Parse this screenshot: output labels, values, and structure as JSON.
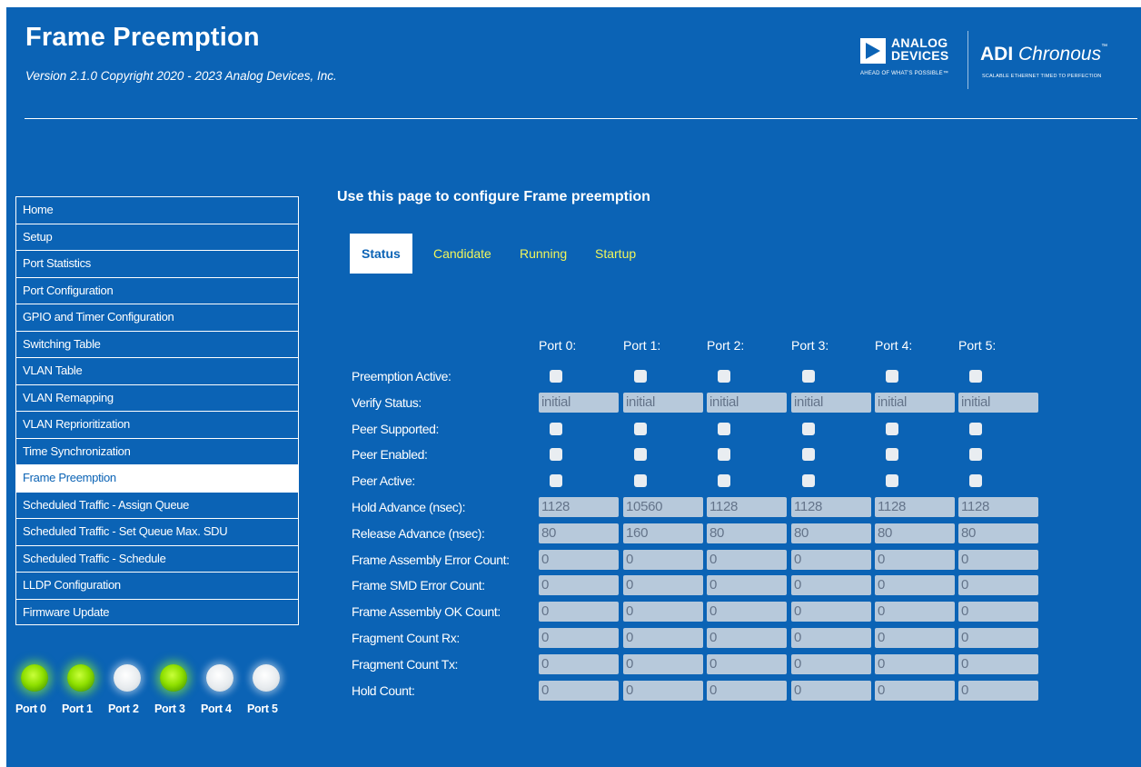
{
  "header": {
    "title": "Frame Preemption",
    "version": "Version 2.1.0 Copyright 2020 - 2023 Analog Devices, Inc.",
    "logo_left": {
      "name_line1": "ANALOG",
      "name_line2": "DEVICES",
      "tagline": "AHEAD OF WHAT'S POSSIBLE™"
    },
    "logo_right": {
      "brand_bold": "ADI",
      "brand_italic": "Chronous",
      "trademark": "™",
      "tagline": "SCALABLE ETHERNET TIMED TO PERFECTION"
    }
  },
  "sidebar": {
    "items": [
      {
        "label": "Home"
      },
      {
        "label": "Setup"
      },
      {
        "label": "Port Statistics"
      },
      {
        "label": "Port Configuration"
      },
      {
        "label": "GPIO and Timer Configuration"
      },
      {
        "label": "Switching Table"
      },
      {
        "label": "VLAN Table"
      },
      {
        "label": "VLAN Remapping"
      },
      {
        "label": "VLAN Reprioritization"
      },
      {
        "label": "Time Synchronization"
      },
      {
        "label": "Frame Preemption",
        "active": true
      },
      {
        "label": "Scheduled Traffic - Assign Queue"
      },
      {
        "label": "Scheduled Traffic - Set Queue Max. SDU"
      },
      {
        "label": "Scheduled Traffic - Schedule"
      },
      {
        "label": "LLDP Configuration"
      },
      {
        "label": "Firmware Update"
      }
    ]
  },
  "leds": [
    {
      "label": "Port 0",
      "state": "on"
    },
    {
      "label": "Port 1",
      "state": "on"
    },
    {
      "label": "Port 2",
      "state": "off"
    },
    {
      "label": "Port 3",
      "state": "on"
    },
    {
      "label": "Port 4",
      "state": "off"
    },
    {
      "label": "Port 5",
      "state": "off"
    }
  ],
  "main": {
    "heading": "Use this page to configure Frame preemption",
    "tabs": [
      {
        "label": "Status",
        "active": true
      },
      {
        "label": "Candidate"
      },
      {
        "label": "Running"
      },
      {
        "label": "Startup"
      }
    ],
    "ports": [
      "Port 0:",
      "Port 1:",
      "Port 2:",
      "Port 3:",
      "Port 4:",
      "Port 5:"
    ],
    "rows": [
      {
        "label": "Preemption Active:",
        "kind": "checkbox"
      },
      {
        "label": "Verify Status:",
        "kind": "text",
        "values": [
          "initial",
          "initial",
          "initial",
          "initial",
          "initial",
          "initial"
        ]
      },
      {
        "label": "Peer Supported:",
        "kind": "checkbox"
      },
      {
        "label": "Peer Enabled:",
        "kind": "checkbox"
      },
      {
        "label": "Peer Active:",
        "kind": "checkbox"
      },
      {
        "label": "Hold Advance (nsec):",
        "kind": "text",
        "values": [
          "1128",
          "10560",
          "1128",
          "1128",
          "1128",
          "1128"
        ]
      },
      {
        "label": "Release Advance (nsec):",
        "kind": "text",
        "values": [
          "80",
          "160",
          "80",
          "80",
          "80",
          "80"
        ]
      },
      {
        "label": "Frame Assembly Error Count:",
        "kind": "text",
        "values": [
          "0",
          "0",
          "0",
          "0",
          "0",
          "0"
        ]
      },
      {
        "label": "Frame SMD Error Count:",
        "kind": "text",
        "values": [
          "0",
          "0",
          "0",
          "0",
          "0",
          "0"
        ]
      },
      {
        "label": "Frame Assembly OK Count:",
        "kind": "text",
        "values": [
          "0",
          "0",
          "0",
          "0",
          "0",
          "0"
        ]
      },
      {
        "label": "Fragment Count Rx:",
        "kind": "text",
        "values": [
          "0",
          "0",
          "0",
          "0",
          "0",
          "0"
        ]
      },
      {
        "label": "Fragment Count Tx:",
        "kind": "text",
        "values": [
          "0",
          "0",
          "0",
          "0",
          "0",
          "0"
        ]
      },
      {
        "label": "Hold Count:",
        "kind": "text",
        "values": [
          "0",
          "0",
          "0",
          "0",
          "0",
          "0"
        ]
      }
    ]
  },
  "colors": {
    "background": "#0b63b5",
    "tab_link": "#f0f55a",
    "field": "#b7c9db",
    "led_on": "#8fe000",
    "led_off": "#e8ecef"
  }
}
